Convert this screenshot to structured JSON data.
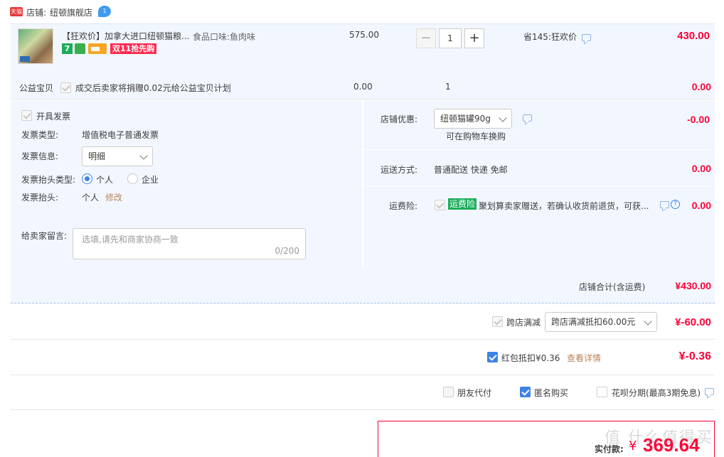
{
  "shop": {
    "tmall_badge": "天猫",
    "label": "店铺:",
    "name": "纽顿旗舰店"
  },
  "item": {
    "title": "【狂欢价】加拿大进口纽顿猫粮...",
    "spec": "食品口味:鱼肉味",
    "price": "575.00",
    "quantity": "1",
    "discount_note": "省145:狂欢价",
    "subtotal": "430.00",
    "badges": {
      "seven": "7",
      "promo": "双11抢先购"
    }
  },
  "charity": {
    "label": "公益宝贝",
    "text": "成交后卖家将捐赠0.02元给公益宝贝计划",
    "price": "0.00",
    "quantity": "1",
    "subtotal": "0.00"
  },
  "invoice": {
    "open_label": "开具发票",
    "type_label": "发票类型:",
    "type_value": "增值税电子普通发票",
    "info_label": "发票信息:",
    "info_value": "明细",
    "header_type_label": "发票抬头类型:",
    "personal": "个人",
    "company": "企业",
    "header_label": "发票抬头:",
    "header_value": "个人",
    "edit": "修改"
  },
  "message": {
    "label": "给卖家留言:",
    "placeholder": "选填,请先和商家协商一致",
    "counter": "0/200"
  },
  "shop_discount": {
    "label": "店铺优惠:",
    "value": "纽顿猫罐90g",
    "note": "可在购物车换购",
    "amount": "-0.00"
  },
  "shipping": {
    "label": "运送方式:",
    "value": "普通配送 快递 免邮",
    "amount": "0.00"
  },
  "insurance": {
    "label": "运费险:",
    "tag": "运费险",
    "text": "聚划算卖家赠送，若确认收货前退货，可获...",
    "amount": "0.00"
  },
  "shop_total": {
    "label": "店铺合计(含运费)",
    "amount": "¥430.00"
  },
  "cross_store": {
    "label": "跨店满减",
    "select": "跨店满减抵扣60.00元",
    "amount": "¥-60.00"
  },
  "red_packet": {
    "label": "红包抵扣¥0.36",
    "link": "查看详情",
    "amount": "¥-0.36"
  },
  "options": {
    "friend_pay": "朋友代付",
    "anonymous": "匿名购买",
    "huabei": "花呗分期(最高3期免息)"
  },
  "pay": {
    "label": "实付款:",
    "currency": "¥",
    "amount": "369.64"
  },
  "watermark": "值 什么值得买",
  "colors": {
    "accent": "#ff0036",
    "blue": "#3e83e6",
    "panel": "#f2f7ff",
    "green": "#1aad5a"
  }
}
